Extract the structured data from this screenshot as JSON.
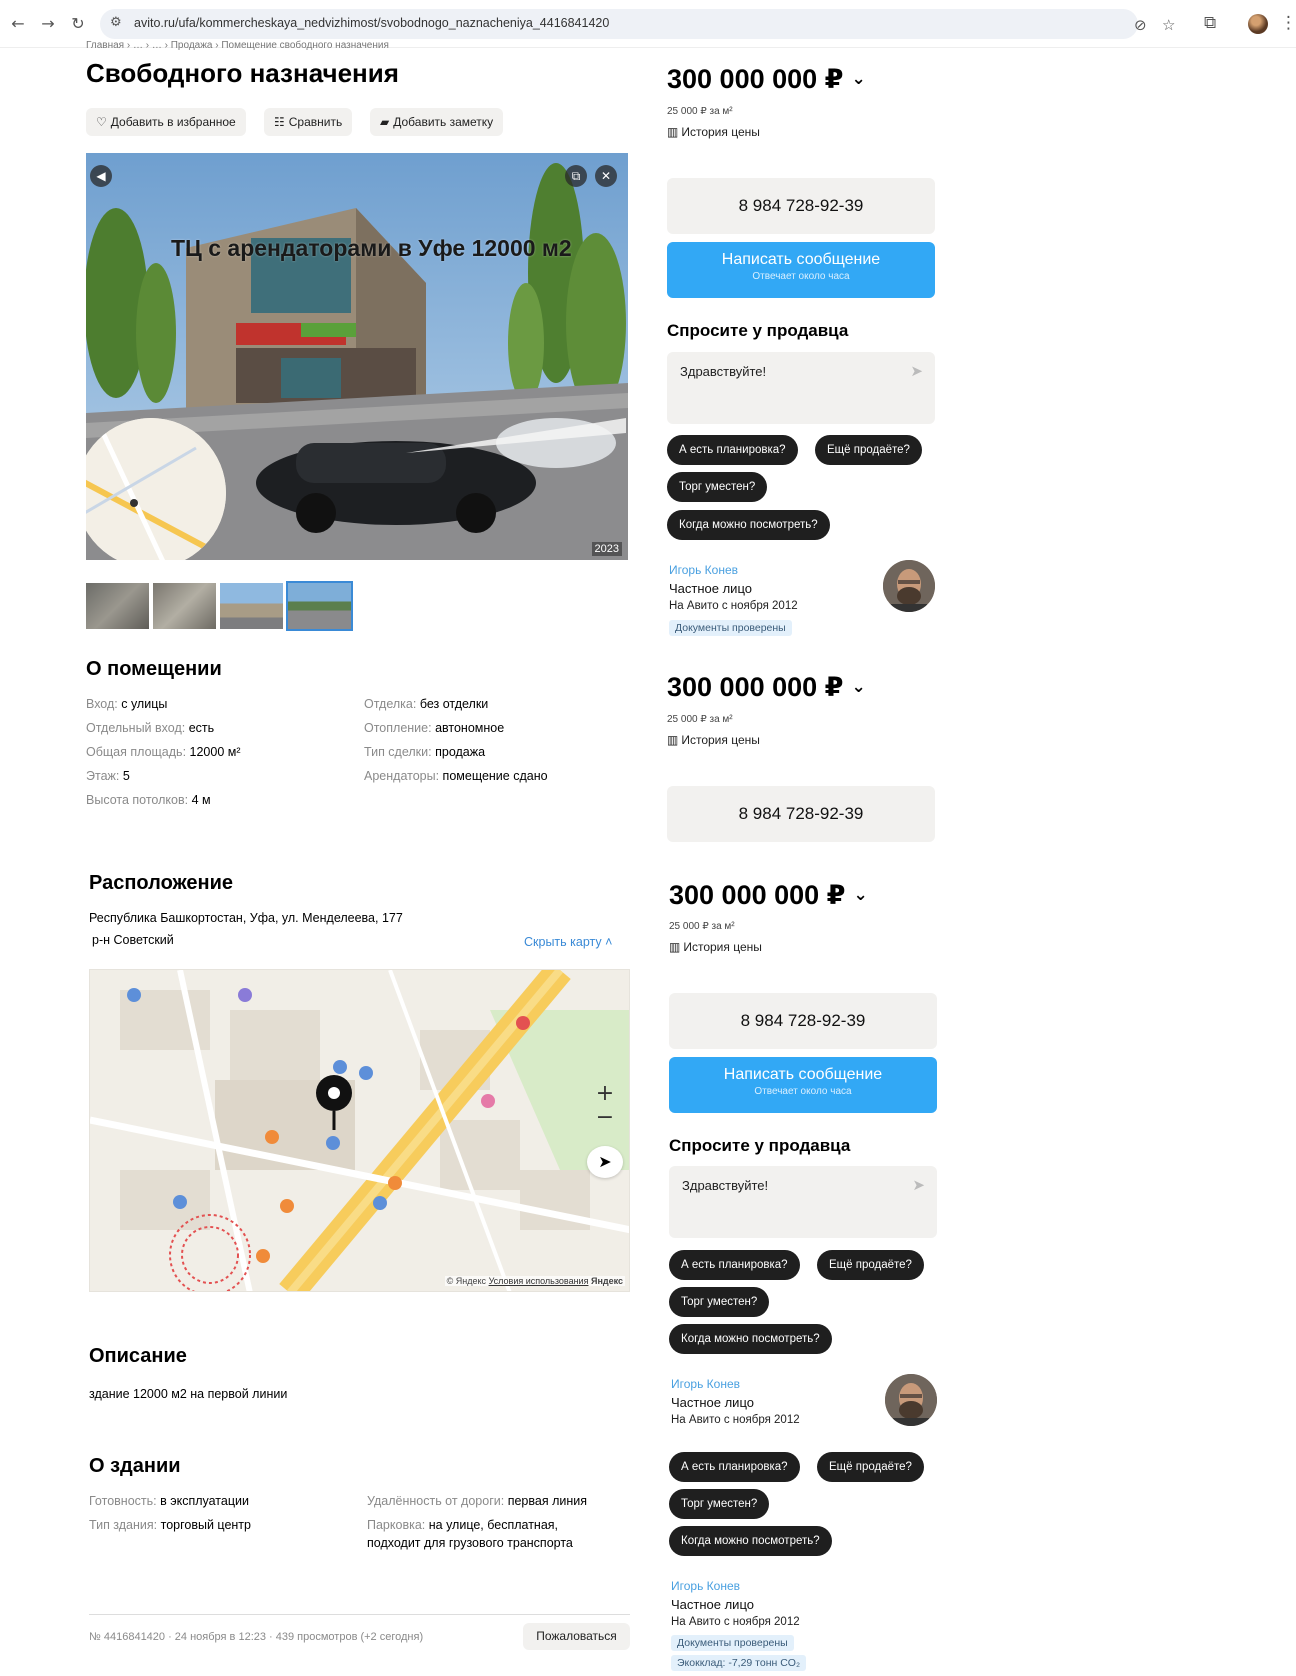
{
  "browser": {
    "url": "avito.ru/ufa/kommercheskaya_nedvizhimost/svobodnogo_naznacheniya_4416841420"
  },
  "breadcrumb": "Главная › … › … › Продажа › Помещение свободного назначения",
  "title": "Свободного назначения",
  "actions": {
    "favorite": "Добавить в избранное",
    "compare": "Сравнить",
    "note": "Добавить заметку"
  },
  "gallery": {
    "overlay_text": "ТЦ с арендаторами в Уфе 12000 м2",
    "year": "2023"
  },
  "about": {
    "title": "О помещении",
    "left": [
      {
        "k": "Вход",
        "v": "с улицы"
      },
      {
        "k": "Отдельный вход",
        "v": "есть"
      },
      {
        "k": "Общая площадь",
        "v": "12000 м²"
      },
      {
        "k": "Этаж",
        "v": "5"
      },
      {
        "k": "Высота потолков",
        "v": "4 м"
      }
    ],
    "right": [
      {
        "k": "Отделка",
        "v": "без отделки"
      },
      {
        "k": "Отопление",
        "v": "автономное"
      },
      {
        "k": "Тип сделки",
        "v": "продажа"
      },
      {
        "k": "Арендаторы",
        "v": "помещение сдано"
      }
    ]
  },
  "location": {
    "title": "Расположение",
    "address": "Республика Башкортостан, Уфа, ул. Менделеева, 177",
    "district": "р-н Советский",
    "hide_map": "Скрыть карту ˄",
    "map_copyright_prefix": "© Яндекс",
    "map_terms": "Условия использования",
    "map_brand": "Яндекс"
  },
  "description": {
    "title": "Описание",
    "text": "здание 12000 м2 на первой линии"
  },
  "building": {
    "title": "О здании",
    "left": [
      {
        "k": "Готовность",
        "v": "в эксплуатации"
      },
      {
        "k": "Тип здания",
        "v": "торговый центр"
      }
    ],
    "right": [
      {
        "k": "Удалённость от дороги",
        "v": "первая линия"
      },
      {
        "k": "Парковка",
        "v": "на улице, бесплатная,"
      },
      {
        "k": "",
        "v": "подходит для грузового транспорта"
      }
    ]
  },
  "footer": {
    "meta": "№ 4416841420 · 24 ноября в 12:23 · 439 просмотров (+2 сегодня)",
    "report": "Пожаловаться"
  },
  "sidebar": {
    "price": "300 000 000 ₽",
    "price_per_m2": "25 000 ₽ за м²",
    "price_history": "История цены",
    "phone": "8 984 728-92-39",
    "message_button": "Написать сообщение",
    "message_sub": "Отвечает около часа",
    "ask_title": "Спросите у продавца",
    "ask_placeholder": "Здравствуйте!",
    "chips": [
      "А есть планировка?",
      "Ещё продаёте?",
      "Торг уместен?",
      "Когда можно посмотреть?"
    ],
    "seller_name": "Игорь Конев",
    "seller_type": "Частное лицо",
    "seller_since": "На Авито с ноября 2012",
    "docs_badge": "Документы проверены",
    "eco_badge": "Экокклад: -7,29 тонн CO₂"
  }
}
